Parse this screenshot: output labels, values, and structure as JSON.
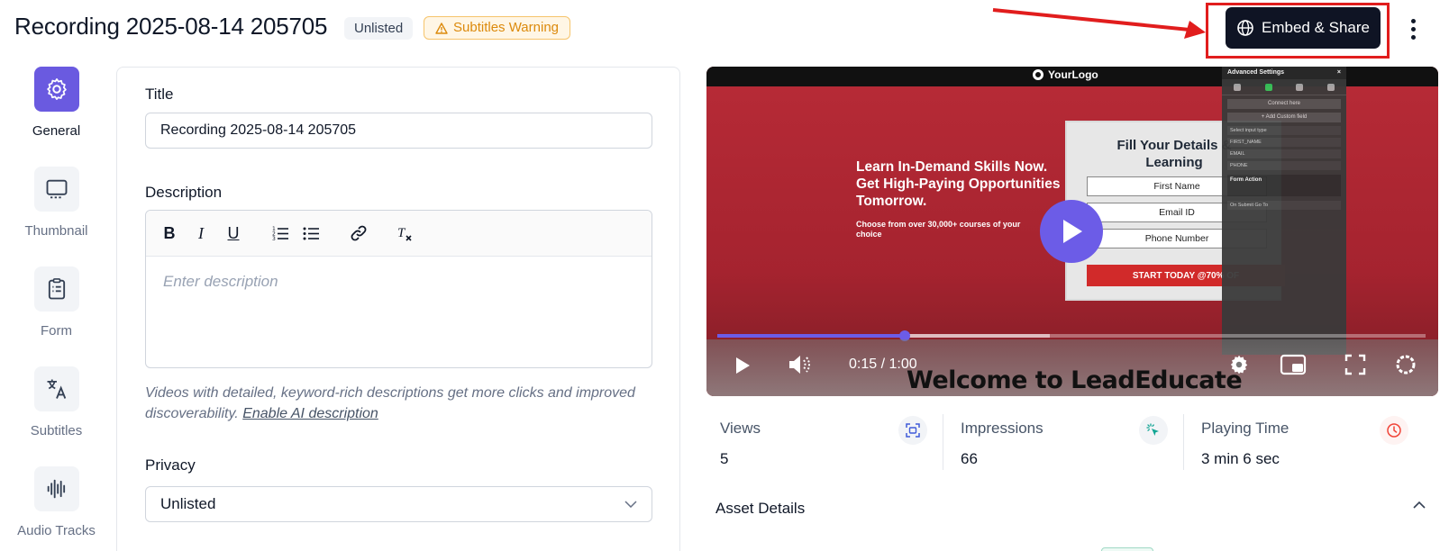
{
  "header": {
    "title": "Recording 2025-08-14 205705",
    "privacy_badge": "Unlisted",
    "warning_badge": "Subtitles Warning",
    "embed_button": "Embed & Share"
  },
  "nav": {
    "items": [
      {
        "label": "General",
        "icon": "gear-icon",
        "active": true
      },
      {
        "label": "Thumbnail",
        "icon": "monitor-icon",
        "active": false
      },
      {
        "label": "Form",
        "icon": "clipboard-icon",
        "active": false
      },
      {
        "label": "Subtitles",
        "icon": "translate-icon",
        "active": false
      },
      {
        "label": "Audio Tracks",
        "icon": "audio-wave-icon",
        "active": false
      }
    ]
  },
  "form": {
    "title_label": "Title",
    "title_value": "Recording 2025-08-14 205705",
    "description_label": "Description",
    "description_placeholder": "Enter description",
    "helper_text": "Videos with detailed, keyword-rich descriptions get more clicks and improved discoverability.",
    "helper_link": "Enable AI description",
    "privacy_label": "Privacy",
    "privacy_value": "Unlisted",
    "toolbar": [
      "bold-icon",
      "italic-icon",
      "underline-icon",
      "ordered-list-icon",
      "bullet-list-icon",
      "link-icon",
      "clear-format-icon"
    ]
  },
  "video": {
    "logo_text": "YourLogo",
    "hero_headline": "Learn In-Demand Skills Now. Get High-Paying Opportunities Tomorrow.",
    "hero_sub": "Choose from over 30,000+ courses of your choice",
    "card_title": "Fill Your Details & Learning",
    "card_fields": [
      "First Name",
      "Email ID",
      "Phone Number"
    ],
    "card_cta": "START TODAY @70% OF",
    "settings_title": "Advanced Settings",
    "settings_connect": "Connect here",
    "settings_add_field": "+ Add Custom field",
    "settings_rows": [
      "Select input type",
      "FIRST_NAME",
      "EMAIL",
      "PHONE"
    ],
    "settings_form_action": "Form Action",
    "settings_submit": "On Submit Go To",
    "time": "0:15 / 1:00",
    "progress": 0.265,
    "buffered": 0.47,
    "caption": "Welcome to LeadEducate"
  },
  "stats": [
    {
      "label": "Views",
      "value": "5",
      "icon": "scan-icon",
      "color": "#3f5bd9"
    },
    {
      "label": "Impressions",
      "value": "66",
      "icon": "cursor-click-icon",
      "color": "#12a594"
    },
    {
      "label": "Playing Time",
      "value": "3 min 6 sec",
      "icon": "clock-icon",
      "color": "#f04438"
    }
  ],
  "asset_details": {
    "title": "Asset Details"
  },
  "colors": {
    "accent": "#6a5ae0",
    "dark_button": "#0f1424",
    "annotation_red": "#e11d1d",
    "warning": "#dc8a0c"
  }
}
